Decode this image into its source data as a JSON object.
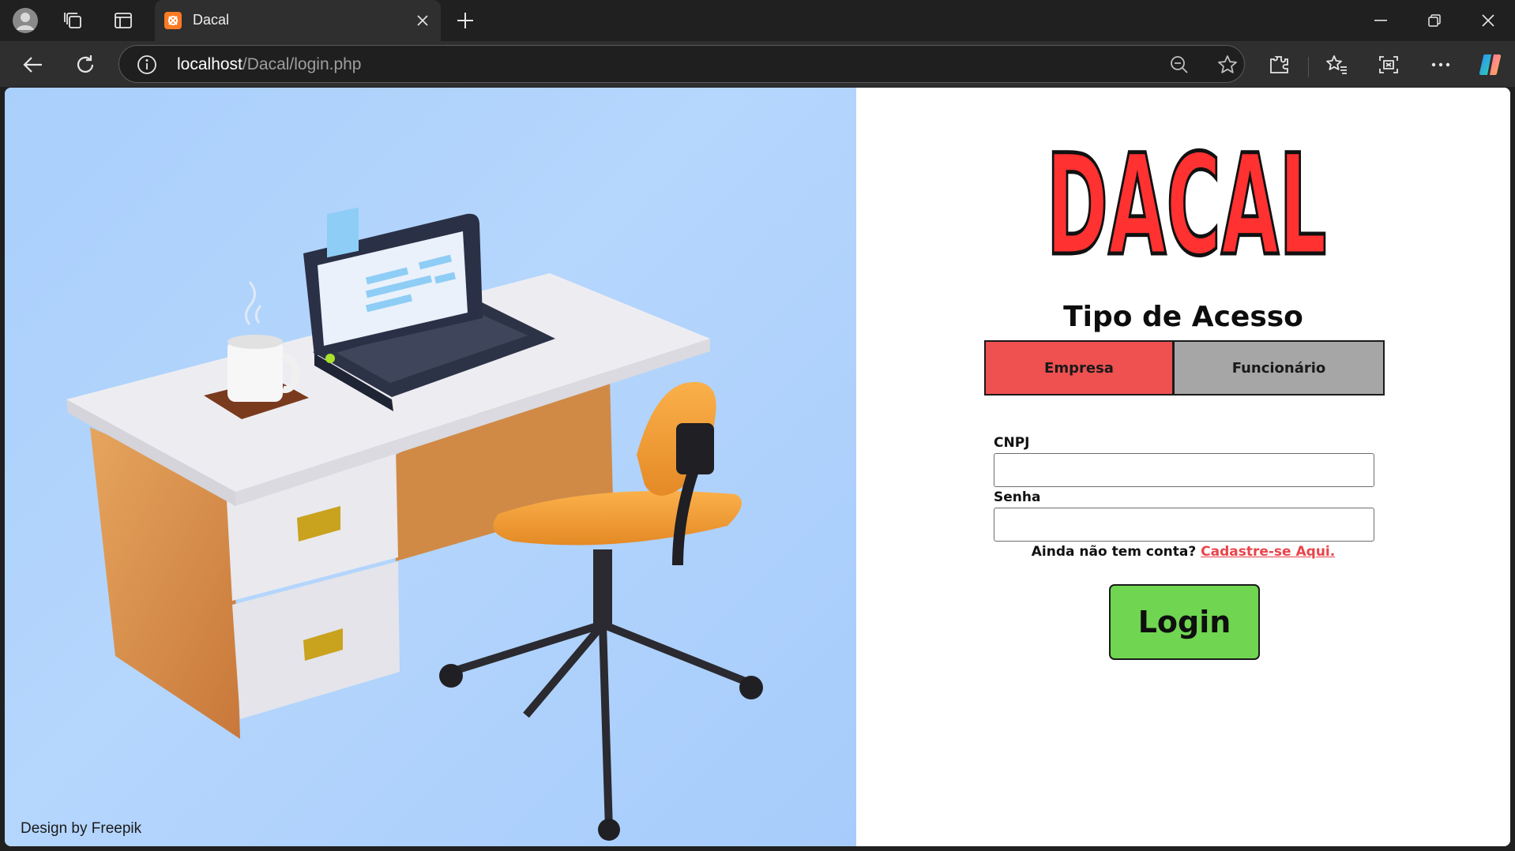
{
  "browser": {
    "tab": {
      "title": "Dacal",
      "favicon": "xampp-icon"
    },
    "address": {
      "host": "localhost",
      "path": "/Dacal/login.php"
    },
    "colors": {
      "chrome_dark": "#202020",
      "chrome_tab": "#2f2f2f"
    }
  },
  "page": {
    "logo_text": "DACAL",
    "access": {
      "title": "Tipo de Acesso",
      "options": [
        "Empresa",
        "Funcionário"
      ],
      "selected": "Empresa"
    },
    "form": {
      "cnpj_label": "CNPJ",
      "cnpj_value": "",
      "senha_label": "Senha",
      "senha_value": "",
      "signup_prompt": "Ainda não tem conta?",
      "signup_link": "Cadastre-se Aqui.",
      "submit_label": "Login"
    },
    "credit": "Design by Freepik",
    "colors": {
      "logo_red": "#ff3131",
      "empresa_bg": "#ef5050",
      "funcionario_bg": "#a6a6a6",
      "login_bg": "#70d551",
      "link": "#e9444a",
      "illustration_bg": "#afd2fc"
    }
  }
}
